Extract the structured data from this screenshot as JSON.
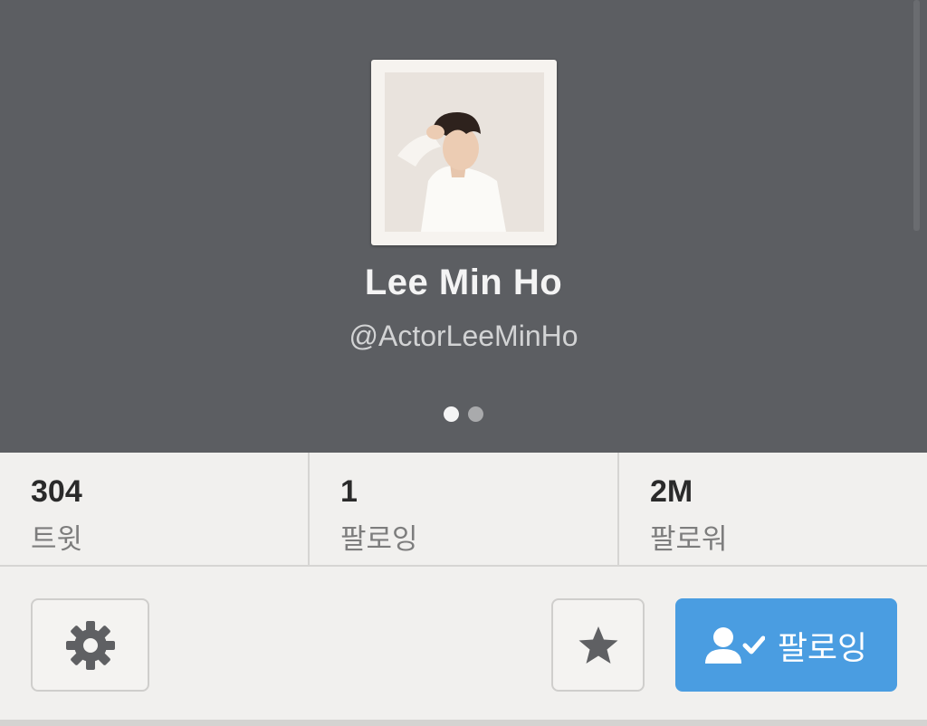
{
  "profile": {
    "name": "Lee Min Ho",
    "handle": "@ActorLeeMinHo"
  },
  "pager": {
    "total": 2,
    "active_index": 0
  },
  "stats": [
    {
      "value": "304",
      "label": "트윗"
    },
    {
      "value": "1",
      "label": "팔로잉"
    },
    {
      "value": "2M",
      "label": "팔로워"
    }
  ],
  "actions": {
    "follow_label": "팔로잉",
    "settings_icon": "gear-icon",
    "favorite_icon": "star-icon",
    "follow_icon": "user-check-icon"
  },
  "colors": {
    "header_bg": "#5c5e62",
    "follow_button": "#4a9de1",
    "page_bg": "#f1f0ee"
  }
}
